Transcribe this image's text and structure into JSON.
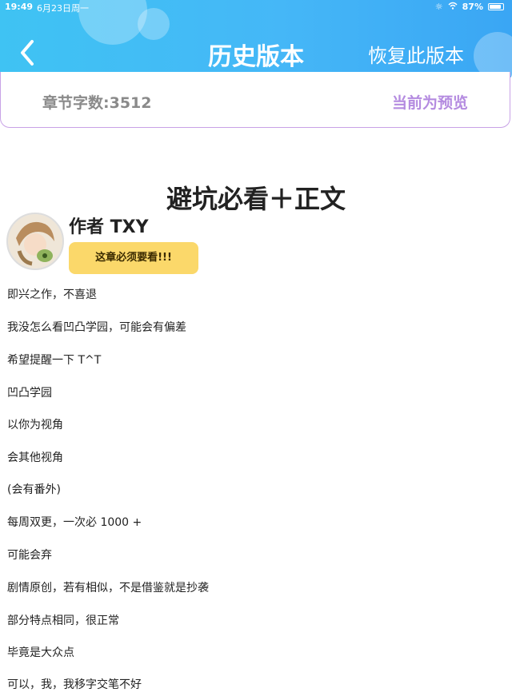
{
  "status_bar": {
    "time": "19:49",
    "date": "6月23日周一",
    "battery_percent": "87%",
    "battery_level": 0.87
  },
  "header": {
    "title": "历史版本",
    "restore_label": "恢复此版本",
    "back_icon": "chevron-left-icon"
  },
  "info": {
    "word_count": "章节字数:3512",
    "preview_status": "当前为预览"
  },
  "chapter": {
    "title": "避坑必看＋正文",
    "author": "作者 TXY",
    "note": "这章必须要看!!!",
    "lines": [
      "即兴之作，不喜退",
      "我没怎么看凹凸学园，可能会有偏差",
      "希望提醒一下 T^T",
      "凹凸学园",
      "以你为视角",
      "会其他视角",
      "(会有番外)",
      "每周双更，一次必 1000 +",
      "可能会弃",
      "剧情原创，若有相似，不是借鉴就是抄袭",
      "部分特点相同，很正常",
      "毕竟是大众点",
      "可以，我，我移字交笔不好"
    ]
  },
  "colors": {
    "header_blue": "#45b7f7",
    "preview_purple": "#b48be0",
    "note_yellow": "#fbd86a"
  }
}
